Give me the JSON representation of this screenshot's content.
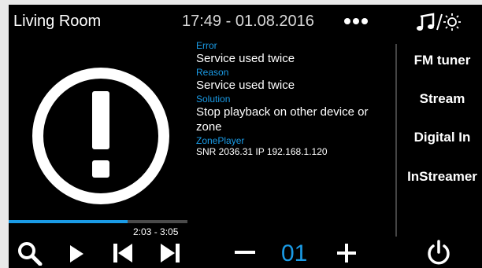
{
  "header": {
    "room": "Living Room",
    "datetime": "17:49 - 01.08.2016"
  },
  "info": {
    "error_label": "Error",
    "error_value": "Service used twice",
    "reason_label": "Reason",
    "reason_value": "Service used twice",
    "solution_label": "Solution",
    "solution_value": "Stop playback on other device or zone",
    "zoneplayer_label": "ZonePlayer",
    "zoneplayer_value": "SNR 2036.31 IP 192.168.1.120"
  },
  "sources": [
    "FM tuner",
    "Stream",
    "Digital In",
    "InStreamer"
  ],
  "playback": {
    "time": "2:03 - 3:05",
    "progress": 0.663
  },
  "zone": {
    "number": "01"
  },
  "colors": {
    "accent": "#1a9be6",
    "background": "#000000"
  },
  "icons": [
    "music-note-icon",
    "brightness-icon",
    "more-dots-icon",
    "warning-icon",
    "search-icon",
    "play-icon",
    "previous-icon",
    "next-icon",
    "minus-icon",
    "plus-icon",
    "power-icon"
  ]
}
